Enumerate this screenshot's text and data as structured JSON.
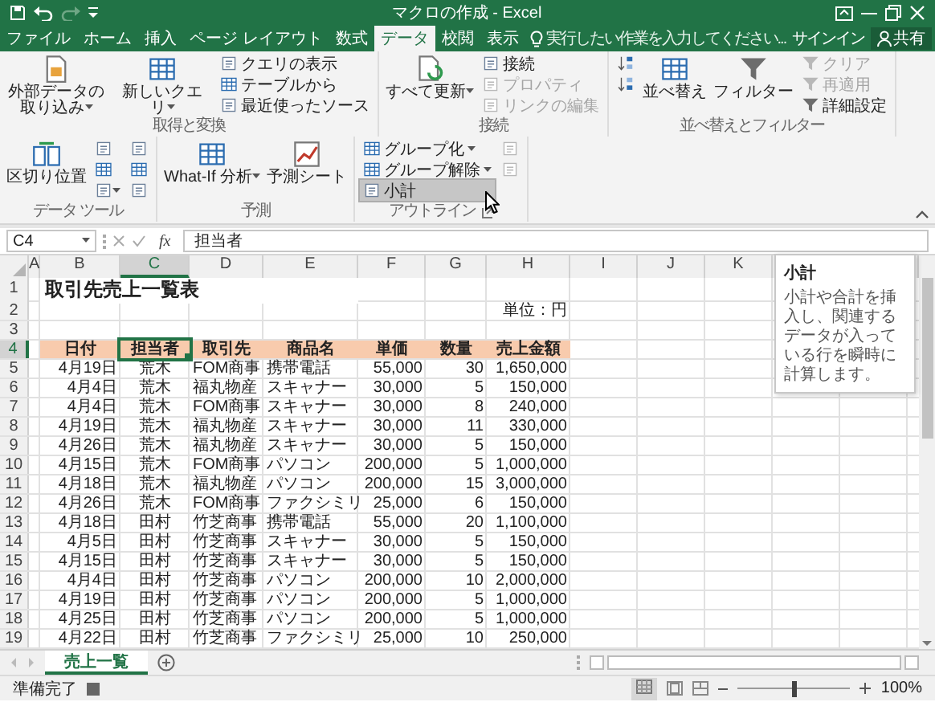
{
  "window": {
    "title": "マクロの作成 - Excel"
  },
  "tabs": [
    {
      "label": "ファイル",
      "selected": false
    },
    {
      "label": "ホーム",
      "selected": false
    },
    {
      "label": "挿入",
      "selected": false
    },
    {
      "label": "ページ レイアウト",
      "selected": false
    },
    {
      "label": "数式",
      "selected": false
    },
    {
      "label": "データ",
      "selected": true
    },
    {
      "label": "校閲",
      "selected": false
    },
    {
      "label": "表示",
      "selected": false
    }
  ],
  "tell_me": {
    "placeholder": "実行したい作業を入力してください..."
  },
  "account": {
    "sign_in": "サインイン",
    "share": "共有"
  },
  "ribbon": {
    "groups": [
      {
        "label": "取得と変換",
        "buttons": [
          {
            "kind": "large",
            "label": "外部データの取り込み",
            "dropdown": true,
            "disabled": false,
            "hovered": false
          },
          {
            "kind": "large",
            "label": "新しいクエリ",
            "dropdown": true,
            "disabled": false,
            "hovered": false
          },
          {
            "kind": "small",
            "label": "クエリの表示",
            "dropdown": false,
            "disabled": false,
            "hovered": false
          },
          {
            "kind": "small",
            "label": "テーブルから",
            "dropdown": false,
            "disabled": false,
            "hovered": false
          },
          {
            "kind": "small",
            "label": "最近使ったソース",
            "dropdown": false,
            "disabled": false,
            "hovered": false
          }
        ]
      },
      {
        "label": "接続",
        "buttons": [
          {
            "kind": "large",
            "label": "すべて更新",
            "dropdown": true,
            "disabled": false,
            "hovered": false
          },
          {
            "kind": "small",
            "label": "接続",
            "dropdown": false,
            "disabled": false,
            "hovered": false
          },
          {
            "kind": "small",
            "label": "プロパティ",
            "dropdown": false,
            "disabled": true,
            "hovered": false
          },
          {
            "kind": "small",
            "label": "リンクの編集",
            "dropdown": false,
            "disabled": true,
            "hovered": false
          }
        ]
      },
      {
        "label": "並べ替えとフィルター",
        "buttons": [
          {
            "kind": "icon",
            "dropdown": false,
            "disabled": false,
            "hovered": false
          },
          {
            "kind": "icon",
            "dropdown": false,
            "disabled": false,
            "hovered": false
          },
          {
            "kind": "large",
            "label": "並べ替え",
            "dropdown": false,
            "disabled": false,
            "hovered": false
          },
          {
            "kind": "large",
            "label": "フィルター",
            "dropdown": false,
            "disabled": false,
            "hovered": false
          },
          {
            "kind": "small",
            "label": "クリア",
            "dropdown": false,
            "disabled": true,
            "hovered": false
          },
          {
            "kind": "small",
            "label": "再適用",
            "dropdown": false,
            "disabled": true,
            "hovered": false
          },
          {
            "kind": "small",
            "label": "詳細設定",
            "dropdown": false,
            "disabled": false,
            "hovered": false
          }
        ]
      },
      {
        "label": "データ ツール",
        "buttons": [
          {
            "kind": "large",
            "label": "区切り位置",
            "dropdown": false,
            "disabled": false,
            "hovered": false
          },
          {
            "kind": "icon",
            "dropdown": false,
            "disabled": false,
            "hovered": false
          },
          {
            "kind": "icon",
            "dropdown": false,
            "disabled": false,
            "hovered": false
          },
          {
            "kind": "icon",
            "dropdown": true,
            "disabled": false,
            "hovered": false
          },
          {
            "kind": "icon",
            "dropdown": false,
            "disabled": false,
            "hovered": false
          },
          {
            "kind": "icon",
            "dropdown": false,
            "disabled": false,
            "hovered": false
          },
          {
            "kind": "icon",
            "dropdown": false,
            "disabled": false,
            "hovered": false
          }
        ]
      },
      {
        "label": "予測",
        "buttons": [
          {
            "kind": "large",
            "label": "What-If 分析",
            "dropdown": true,
            "disabled": false,
            "hovered": false
          },
          {
            "kind": "large",
            "label": "予測シート",
            "dropdown": false,
            "disabled": false,
            "hovered": false
          }
        ]
      },
      {
        "label": "アウトライン",
        "buttons": [
          {
            "kind": "small",
            "label": "グループ化",
            "dropdown": true,
            "disabled": false,
            "hovered": false
          },
          {
            "kind": "small",
            "label": "グループ解除",
            "dropdown": true,
            "disabled": false,
            "hovered": false
          },
          {
            "kind": "small",
            "label": "小計",
            "dropdown": false,
            "disabled": false,
            "hovered": true
          },
          {
            "kind": "icon",
            "dropdown": false,
            "disabled": true,
            "hovered": false
          },
          {
            "kind": "icon",
            "dropdown": false,
            "disabled": true,
            "hovered": false
          }
        ]
      }
    ]
  },
  "formula_bar": {
    "name_box": "C4",
    "function_button": "fx",
    "formula": "担当者"
  },
  "sheet": {
    "columns": [
      {
        "label": "A",
        "selected": false
      },
      {
        "label": "B",
        "selected": false
      },
      {
        "label": "C",
        "selected": true
      },
      {
        "label": "D",
        "selected": false
      },
      {
        "label": "E",
        "selected": false
      },
      {
        "label": "F",
        "selected": false
      },
      {
        "label": "G",
        "selected": false
      },
      {
        "label": "H",
        "selected": false
      },
      {
        "label": "I",
        "selected": false
      },
      {
        "label": "J",
        "selected": false
      },
      {
        "label": "K",
        "selected": false
      }
    ],
    "rows": [
      {
        "number": "1",
        "selected": false,
        "kind": "title",
        "text": "取引先売上一覧表"
      },
      {
        "number": "2",
        "selected": false,
        "kind": "unit",
        "text": "単位：円"
      },
      {
        "number": "3",
        "selected": false,
        "kind": "blank"
      },
      {
        "number": "4",
        "selected": true,
        "kind": "header",
        "cells": [
          "日付",
          "担当者",
          "取引先",
          "商品名",
          "単価",
          "数量",
          "売上金額"
        ]
      },
      {
        "number": "5",
        "selected": false,
        "kind": "data",
        "cells": [
          "4月19日",
          "荒木",
          "FOM商事",
          "携帯電話",
          "55,000",
          "30",
          "1,650,000"
        ]
      },
      {
        "number": "6",
        "selected": false,
        "kind": "data",
        "cells": [
          "4月4日",
          "荒木",
          "福丸物産",
          "スキャナー",
          "30,000",
          "5",
          "150,000"
        ]
      },
      {
        "number": "7",
        "selected": false,
        "kind": "data",
        "cells": [
          "4月4日",
          "荒木",
          "FOM商事",
          "スキャナー",
          "30,000",
          "8",
          "240,000"
        ]
      },
      {
        "number": "8",
        "selected": false,
        "kind": "data",
        "cells": [
          "4月19日",
          "荒木",
          "福丸物産",
          "スキャナー",
          "30,000",
          "11",
          "330,000"
        ]
      },
      {
        "number": "9",
        "selected": false,
        "kind": "data",
        "cells": [
          "4月26日",
          "荒木",
          "福丸物産",
          "スキャナー",
          "30,000",
          "5",
          "150,000"
        ]
      },
      {
        "number": "10",
        "selected": false,
        "kind": "data",
        "cells": [
          "4月15日",
          "荒木",
          "FOM商事",
          "パソコン",
          "200,000",
          "5",
          "1,000,000"
        ]
      },
      {
        "number": "11",
        "selected": false,
        "kind": "data",
        "cells": [
          "4月18日",
          "荒木",
          "福丸物産",
          "パソコン",
          "200,000",
          "15",
          "3,000,000"
        ]
      },
      {
        "number": "12",
        "selected": false,
        "kind": "data",
        "cells": [
          "4月26日",
          "荒木",
          "FOM商事",
          "ファクシミリ",
          "25,000",
          "6",
          "150,000"
        ]
      },
      {
        "number": "13",
        "selected": false,
        "kind": "data",
        "cells": [
          "4月18日",
          "田村",
          "竹芝商事",
          "携帯電話",
          "55,000",
          "20",
          "1,100,000"
        ]
      },
      {
        "number": "14",
        "selected": false,
        "kind": "data",
        "cells": [
          "4月5日",
          "田村",
          "竹芝商事",
          "スキャナー",
          "30,000",
          "5",
          "150,000"
        ]
      },
      {
        "number": "15",
        "selected": false,
        "kind": "data",
        "cells": [
          "4月15日",
          "田村",
          "竹芝商事",
          "スキャナー",
          "30,000",
          "5",
          "150,000"
        ]
      },
      {
        "number": "16",
        "selected": false,
        "kind": "data",
        "cells": [
          "4月4日",
          "田村",
          "竹芝商事",
          "パソコン",
          "200,000",
          "10",
          "2,000,000"
        ]
      },
      {
        "number": "17",
        "selected": false,
        "kind": "data",
        "cells": [
          "4月19日",
          "田村",
          "竹芝商事",
          "パソコン",
          "200,000",
          "5",
          "1,000,000"
        ]
      },
      {
        "number": "18",
        "selected": false,
        "kind": "data",
        "cells": [
          "4月25日",
          "田村",
          "竹芝商事",
          "パソコン",
          "200,000",
          "5",
          "1,000,000"
        ]
      },
      {
        "number": "19",
        "selected": false,
        "kind": "data",
        "cells": [
          "4月22日",
          "田村",
          "竹芝商事",
          "ファクシミリ",
          "25,000",
          "10",
          "250,000"
        ]
      }
    ]
  },
  "sheet_tabs": [
    {
      "label": "売上一覧",
      "selected": true
    }
  ],
  "status_bar": {
    "status": "準備完了",
    "zoom": {
      "level": 0.5
    },
    "zoom_text": "100%"
  },
  "tooltip": {
    "title": "小計",
    "text": "小計や合計を挿入し、関連するデータが入っている行を瞬時に計算します。"
  }
}
